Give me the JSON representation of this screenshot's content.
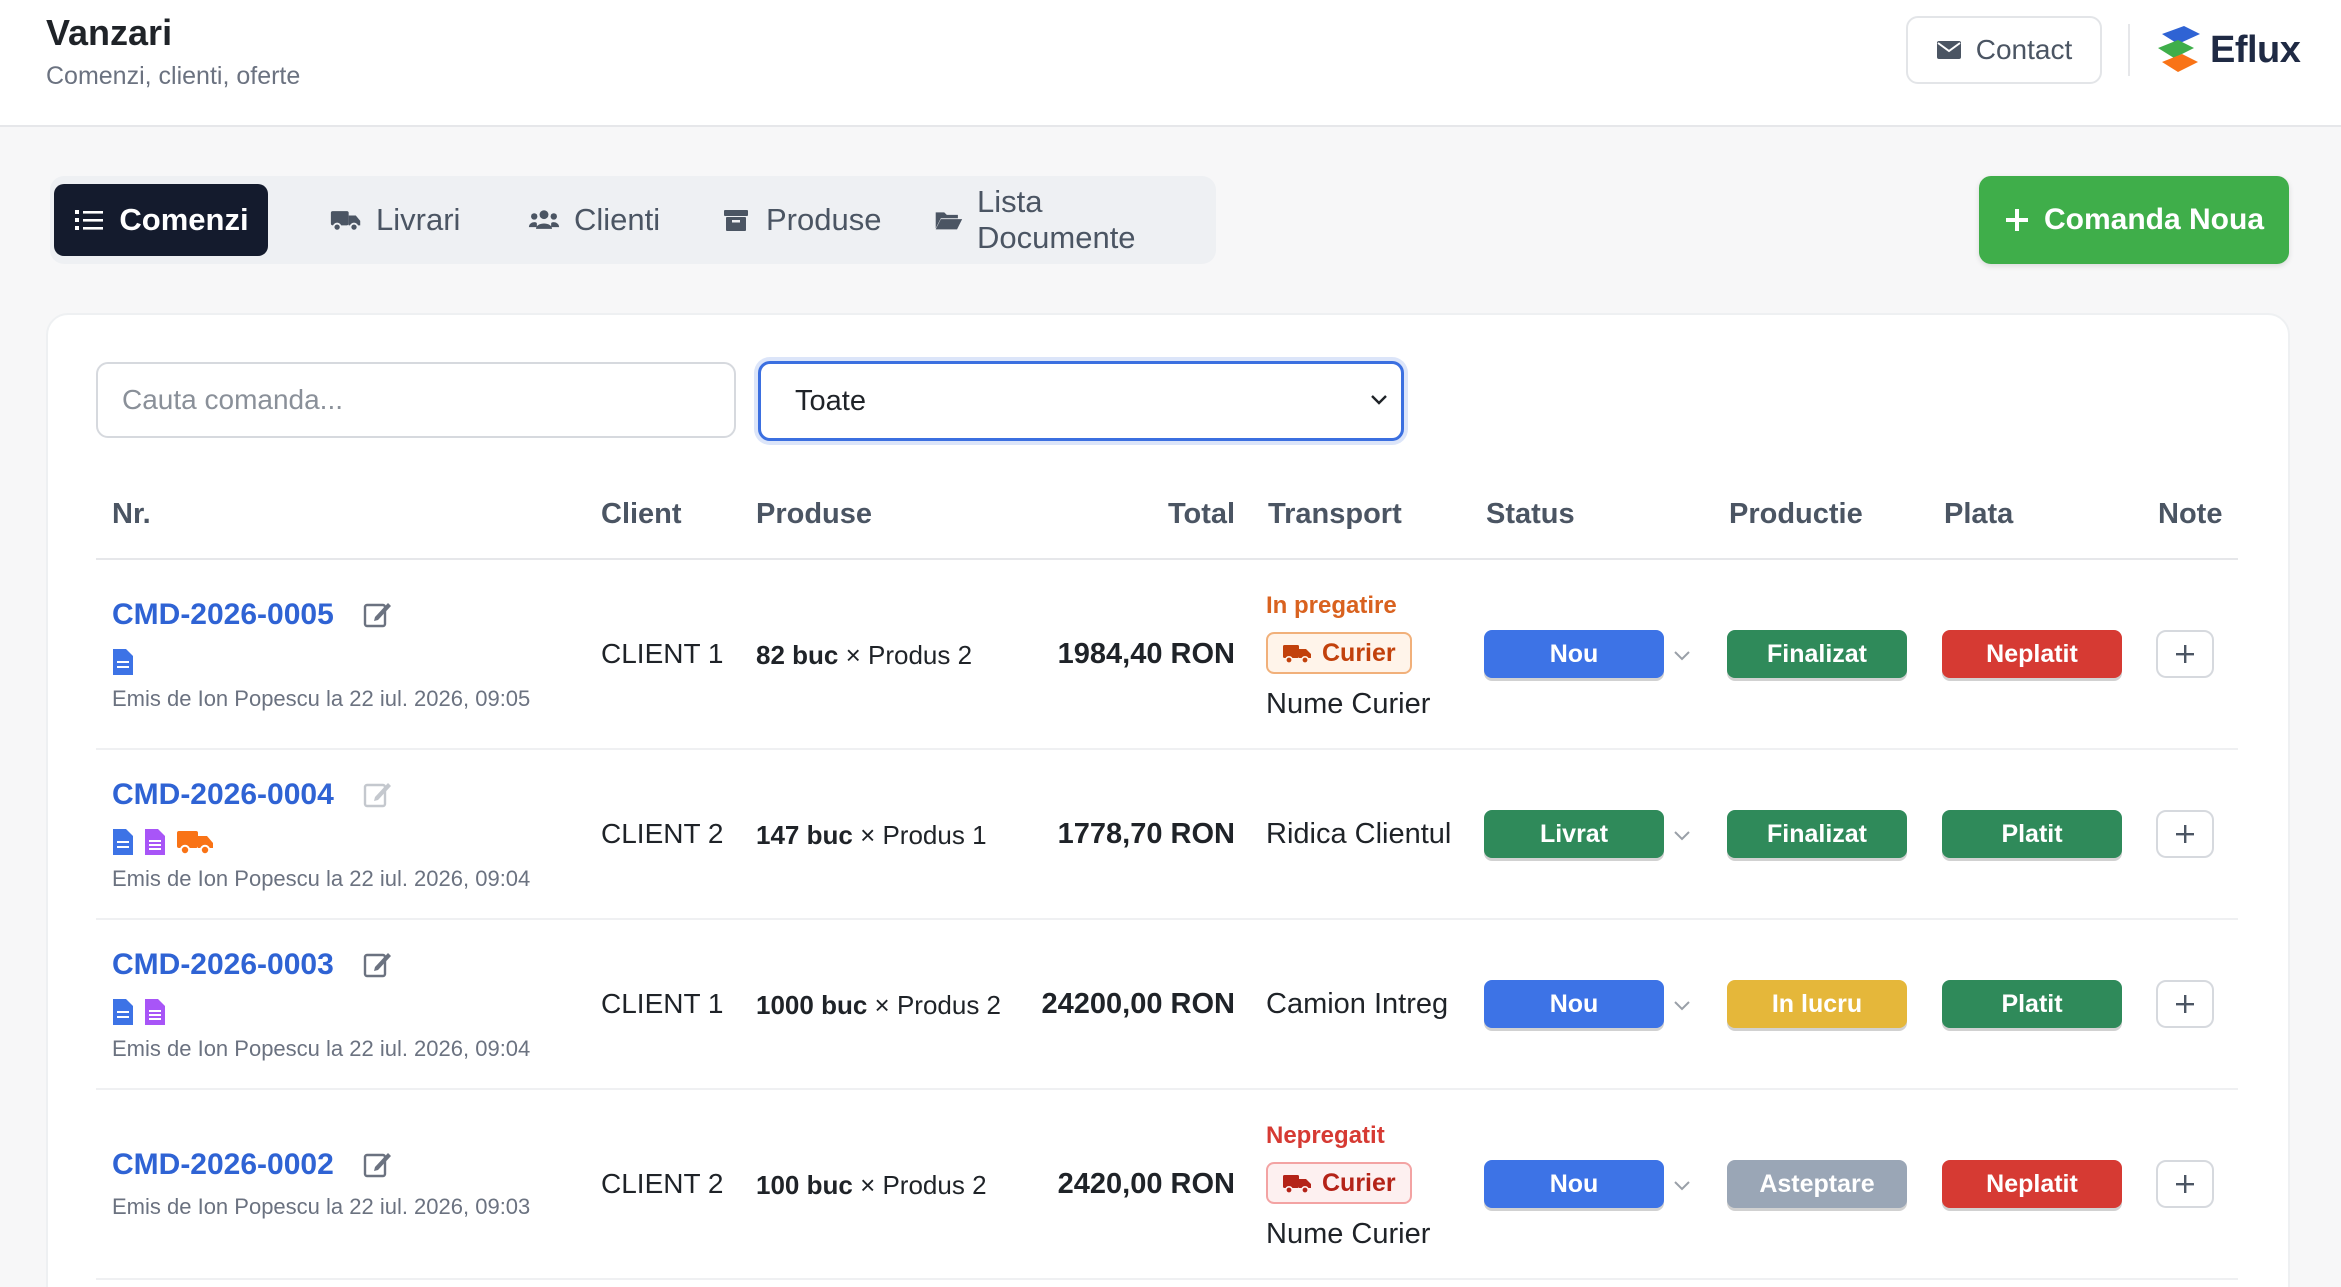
{
  "header": {
    "title": "Vanzari",
    "subtitle": "Comenzi, clienti, oferte",
    "contact_label": "Contact",
    "logo_text": "Eflux"
  },
  "tabs": [
    {
      "label": "Comenzi",
      "icon": "list-icon",
      "active": true
    },
    {
      "label": "Livrari",
      "icon": "truck-icon"
    },
    {
      "label": "Clienti",
      "icon": "users-icon"
    },
    {
      "label": "Produse",
      "icon": "box-icon"
    },
    {
      "label": "Lista Documente",
      "icon": "folder-open-icon"
    }
  ],
  "new_order_label": "Comanda Noua",
  "filters": {
    "search_placeholder": "Cauta comanda...",
    "status_selected": "Toate"
  },
  "columns": [
    "Nr.",
    "Client",
    "Produse",
    "Total",
    "Transport",
    "Status",
    "Productie",
    "Plata",
    "Note"
  ],
  "colors": {
    "accent": "#2f63d4",
    "green": "#2f8a5a",
    "blue": "#3d73e6",
    "red": "#d63a33",
    "yellow": "#e5b73a",
    "gray": "#9aa6b6",
    "primary_button": "#3fae4a"
  },
  "orders": [
    {
      "nr": "CMD-2026-0005",
      "docs": [
        "doc-blue"
      ],
      "emis": "Emis de Ion Popescu la 22 iul. 2026, 09:05",
      "client": "CLIENT 1",
      "qty": "82 buc",
      "product": "× Produs 2",
      "total": "1984,40 RON",
      "transport_state": "In pregatire",
      "transport_badge": "Curier",
      "transport_name": "Nume Curier",
      "status": "Nou",
      "productie": "Finalizat",
      "plata": "Neplatit"
    },
    {
      "nr": "CMD-2026-0004",
      "docs": [
        "doc-blue",
        "doc-purple",
        "truck-orange"
      ],
      "emis": "Emis de Ion Popescu la 22 iul. 2026, 09:04",
      "client": "CLIENT 2",
      "qty": "147 buc",
      "product": "× Produs 1",
      "total": "1778,70 RON",
      "transport_text": "Ridica Clientul",
      "status": "Livrat",
      "productie": "Finalizat",
      "plata": "Platit"
    },
    {
      "nr": "CMD-2026-0003",
      "docs": [
        "doc-blue",
        "doc-purple"
      ],
      "emis": "Emis de Ion Popescu la 22 iul. 2026, 09:04",
      "client": "CLIENT 1",
      "qty": "1000 buc",
      "product": "× Produs 2",
      "total": "24200,00 RON",
      "transport_text": "Camion Intreg",
      "status": "Nou",
      "productie": "In lucru",
      "plata": "Platit"
    },
    {
      "nr": "CMD-2026-0002",
      "docs": [],
      "emis": "Emis de Ion Popescu la 22 iul. 2026, 09:03",
      "client": "CLIENT 2",
      "qty": "100 buc",
      "product": "× Produs 2",
      "total": "2420,00 RON",
      "transport_state": "Nepregatit",
      "transport_badge": "Curier",
      "transport_name": "Nume Curier",
      "status": "Nou",
      "productie": "Asteptare",
      "plata": "Neplatit"
    }
  ]
}
